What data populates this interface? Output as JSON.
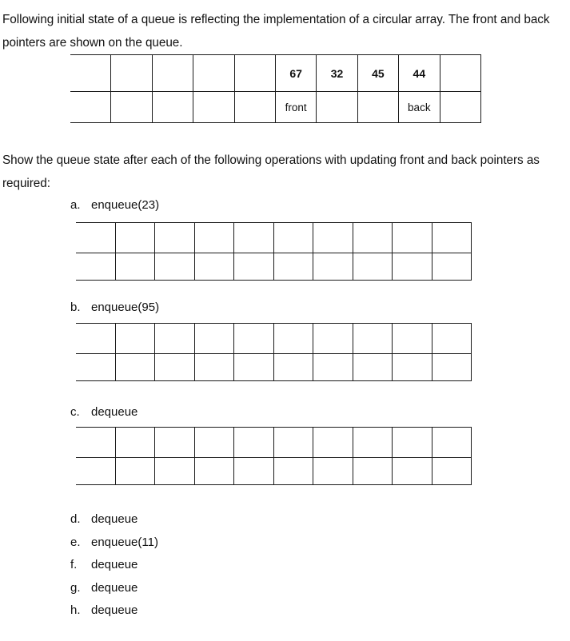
{
  "document": {
    "intro_text": "Following initial state of a queue is reflecting the implementation of a circular array. The front and back pointers are shown on the queue.",
    "instruction_text": "Show the queue state after each of the following operations with updating front and back pointers as required:"
  },
  "initial_queue": {
    "columns": 10,
    "values": [
      "",
      "",
      "",
      "",
      "",
      "67",
      "32",
      "45",
      "44",
      ""
    ],
    "pointers": [
      "",
      "",
      "",
      "",
      "",
      "front",
      "",
      "",
      "back",
      ""
    ],
    "value_cell_0": "",
    "value_cell_1": "",
    "value_cell_2": "",
    "value_cell_3": "",
    "value_cell_4": "",
    "value_cell_5": "67",
    "value_cell_6": "32",
    "value_cell_7": "45",
    "value_cell_8": "44",
    "value_cell_9": "",
    "pointer_cell_0": "",
    "pointer_cell_1": "",
    "pointer_cell_2": "",
    "pointer_cell_3": "",
    "pointer_cell_4": "",
    "pointer_cell_5": "front",
    "pointer_cell_6": "",
    "pointer_cell_7": "",
    "pointer_cell_8": "back",
    "pointer_cell_9": ""
  },
  "operations": [
    {
      "marker": "a.",
      "label": "enqueue(23)",
      "has_table": true
    },
    {
      "marker": "b.",
      "label": "enqueue(95)",
      "has_table": true
    },
    {
      "marker": "c.",
      "label": "dequeue",
      "has_table": true
    },
    {
      "marker": "d.",
      "label": "dequeue",
      "has_table": false
    },
    {
      "marker": "e.",
      "label": "enqueue(11)",
      "has_table": false
    },
    {
      "marker": "f.",
      "label": "dequeue",
      "has_table": false
    },
    {
      "marker": "g.",
      "label": "dequeue",
      "has_table": false
    },
    {
      "marker": "h.",
      "label": "dequeue",
      "has_table": false
    }
  ],
  "blank_tables": {
    "columns": 10,
    "value_row": [
      "",
      "",
      "",
      "",
      "",
      "",
      "",
      "",
      "",
      ""
    ],
    "pointer_row": [
      "",
      "",
      "",
      "",
      "",
      "",
      "",
      "",
      "",
      ""
    ]
  },
  "colors": {
    "page_background": "#ffffff",
    "text": "#111111",
    "table_border": "#1a1a1a"
  }
}
